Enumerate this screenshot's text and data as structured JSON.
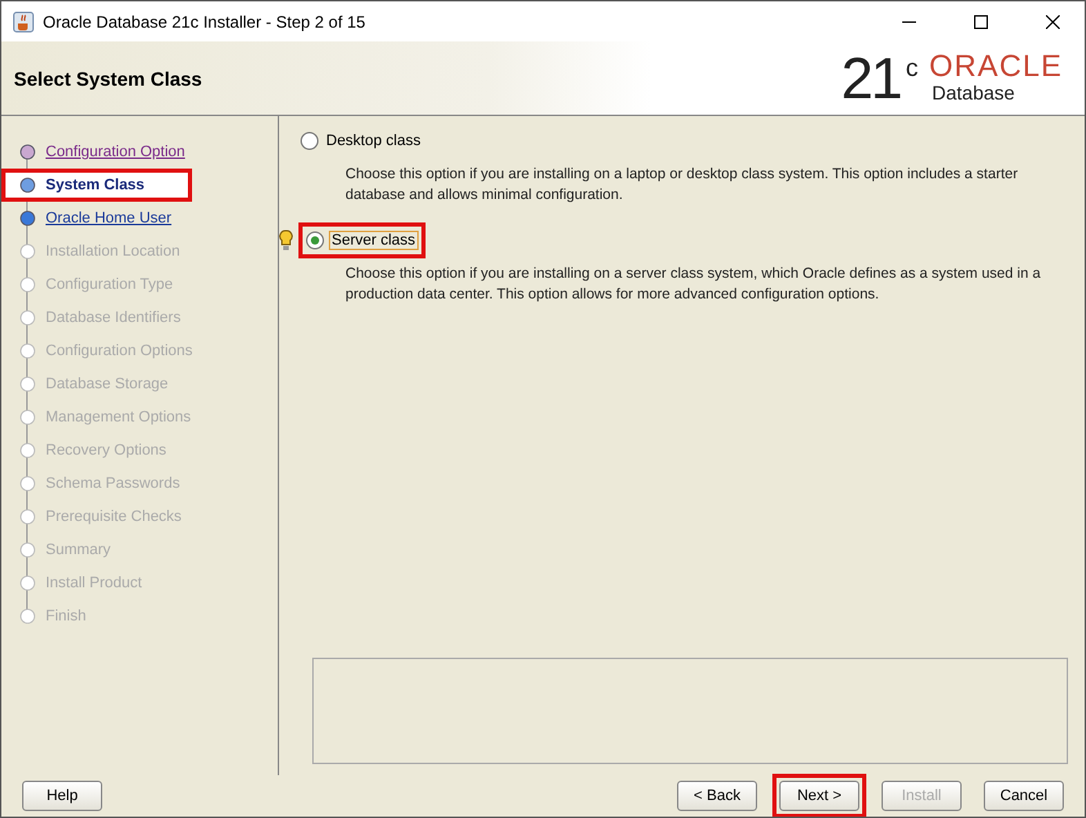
{
  "window": {
    "title": "Oracle Database 21c Installer - Step 2 of 15"
  },
  "header": {
    "title": "Select System Class",
    "logo": {
      "version": "21",
      "superscript": "c",
      "brand": "ORACLE",
      "product": "Database"
    }
  },
  "steps": [
    {
      "label": "Configuration Option",
      "kind": "visited",
      "selected": false,
      "highlighted": false
    },
    {
      "label": "System Class",
      "kind": "current",
      "selected": true,
      "highlighted": true
    },
    {
      "label": "Oracle Home User",
      "kind": "next",
      "selected": false,
      "highlighted": false
    },
    {
      "label": "Installation Location",
      "kind": "pending",
      "selected": false,
      "highlighted": false
    },
    {
      "label": "Configuration Type",
      "kind": "pending",
      "selected": false,
      "highlighted": false
    },
    {
      "label": "Database Identifiers",
      "kind": "pending",
      "selected": false,
      "highlighted": false
    },
    {
      "label": "Configuration Options",
      "kind": "pending",
      "selected": false,
      "highlighted": false
    },
    {
      "label": "Database Storage",
      "kind": "pending",
      "selected": false,
      "highlighted": false
    },
    {
      "label": "Management Options",
      "kind": "pending",
      "selected": false,
      "highlighted": false
    },
    {
      "label": "Recovery Options",
      "kind": "pending",
      "selected": false,
      "highlighted": false
    },
    {
      "label": "Schema Passwords",
      "kind": "pending",
      "selected": false,
      "highlighted": false
    },
    {
      "label": "Prerequisite Checks",
      "kind": "pending",
      "selected": false,
      "highlighted": false
    },
    {
      "label": "Summary",
      "kind": "pending",
      "selected": false,
      "highlighted": false
    },
    {
      "label": "Install Product",
      "kind": "pending",
      "selected": false,
      "highlighted": false
    },
    {
      "label": "Finish",
      "kind": "pending",
      "selected": false,
      "highlighted": false
    }
  ],
  "options": [
    {
      "label": "Desktop class",
      "selected": false,
      "highlighted": false,
      "hint": false,
      "description": "Choose this option if you are installing on a laptop or desktop class system. This option includes a starter database and allows minimal configuration."
    },
    {
      "label": "Server class",
      "selected": true,
      "highlighted": true,
      "hint": true,
      "description": "Choose this option if you are installing on a server class system, which Oracle defines as a system used in a production data center. This option allows for more advanced configuration options."
    }
  ],
  "buttons": [
    {
      "label": "Help",
      "disabled": false,
      "highlighted": false
    },
    {
      "label": "< Back",
      "disabled": false,
      "highlighted": false
    },
    {
      "label": "Next >",
      "disabled": false,
      "highlighted": true
    },
    {
      "label": "Install",
      "disabled": true,
      "highlighted": false
    },
    {
      "label": "Cancel",
      "disabled": false,
      "highlighted": false
    }
  ]
}
